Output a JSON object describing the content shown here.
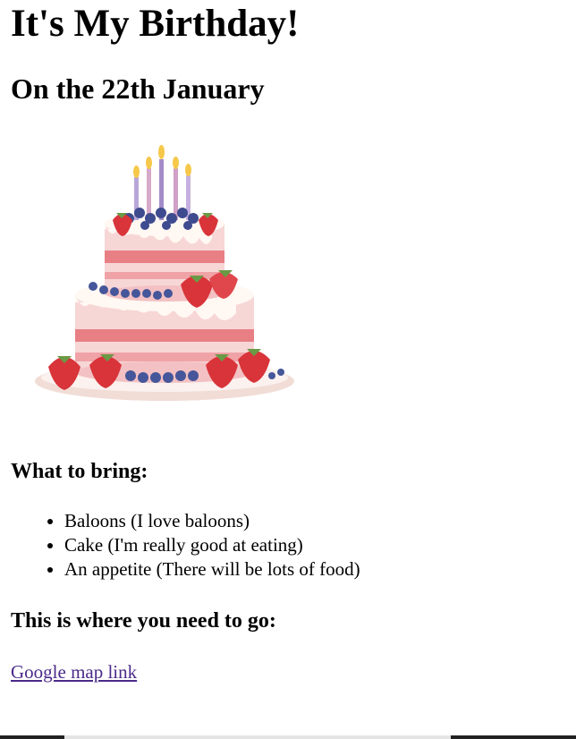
{
  "page": {
    "title": "It's My Birthday!",
    "date_heading": "On the 22th January",
    "bring_heading": "What to bring:",
    "bring_items": [
      "Baloons (I love baloons)",
      "Cake (I'm really good at eating)",
      "An appetite (There will be lots of food)"
    ],
    "where_heading": "This is where you need to go:",
    "map_link_text": "Google map link"
  },
  "icons": {
    "cake": "birthday-cake-image"
  },
  "colors": {
    "link": "#4b2a8a",
    "text": "#000000",
    "background": "#ffffff"
  }
}
